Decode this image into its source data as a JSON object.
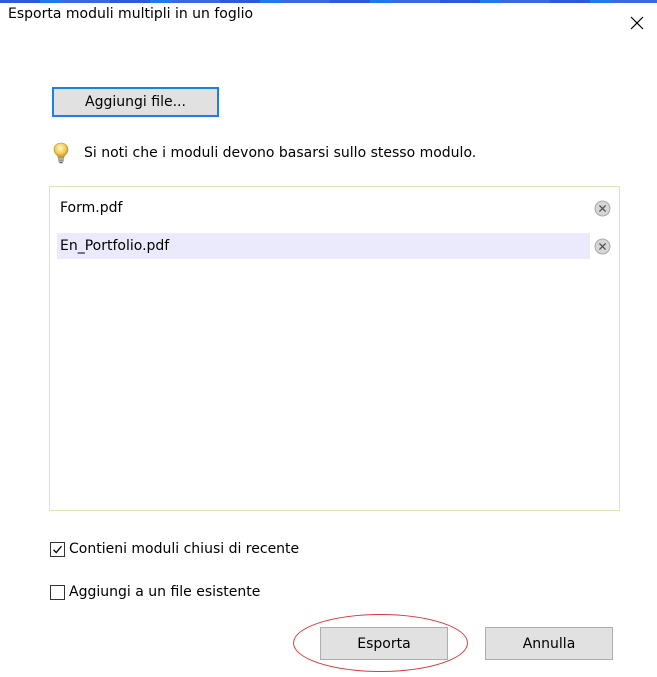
{
  "dialog": {
    "title": "Esporta moduli multipli in un foglio",
    "close_icon": "close-icon"
  },
  "add_files_button": {
    "label": "Aggiungi file..."
  },
  "note": {
    "icon": "lightbulb-icon",
    "text": "Si noti che i moduli devono basarsi sullo stesso modulo."
  },
  "file_list": {
    "items": [
      {
        "name": "Form.pdf",
        "remove_icon": "remove-circle-icon",
        "selected": false
      },
      {
        "name": "En_Portfolio.pdf",
        "remove_icon": "remove-circle-icon",
        "selected": true
      }
    ]
  },
  "options": {
    "include_recent": {
      "label": "Contieni moduli chiusi di recente",
      "checked": true
    },
    "append_existing": {
      "label": "Aggiungi a un file esistente",
      "checked": false
    }
  },
  "buttons": {
    "export_label": "Esporta",
    "cancel_label": "Annulla"
  },
  "colors": {
    "accent_border": "#1e7fe3",
    "selected_row": "#ebeafc",
    "annotation_ellipse": "#d93a3a"
  }
}
